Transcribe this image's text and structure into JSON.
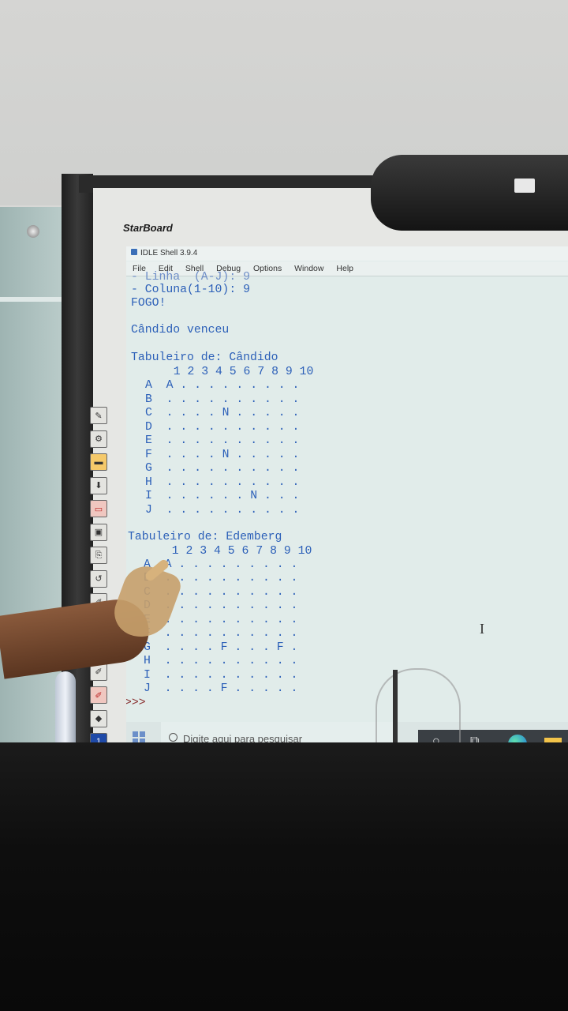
{
  "board_brand": "StarBoard",
  "window": {
    "title": "IDLE Shell 3.9.4",
    "menu": [
      "File",
      "Edit",
      "Shell",
      "Debug",
      "Options",
      "Window",
      "Help"
    ]
  },
  "shell": {
    "line_cut": "- Linha  (A-J): 9",
    "line_coluna": "- Coluna(1-10): 9",
    "line_fogo": "FOGO!",
    "line_winner": "Cândido venceu",
    "prompt": ">>>"
  },
  "boards": [
    {
      "title": "Tabuleiro de: Cândido",
      "header": "  1 2 3 4 5 6 7 8 9 10",
      "rows": [
        "A  A . . . . . . . . .",
        "B  . . . . . . . . . .",
        "C  . . . . N . . . . .",
        "D  . . . . . . . . . .",
        "E  . . . . . . . . . .",
        "F  . . . . N . . . . .",
        "G  . . . . . . . . . .",
        "H  . . . . . . . . . .",
        "I  . . . . . . N . . .",
        "J  . . . . . . . . . ."
      ]
    },
    {
      "title": "Tabuleiro de: Edemberg",
      "header": "  1 2 3 4 5 6 7 8 9 10",
      "rows": [
        "A  A . . . . . . . . .",
        "B  . . . . . . . . . .",
        "C  . . . . . . . . . .",
        "D  . . . . . . . . . .",
        "E  . . . . . . . . . .",
        "F  . . . . . . . . . .",
        "G  . . . . F . . . F .",
        "H  . . . . . . . . . .",
        "I  . . . . . . . . . .",
        "J  . . . . F . . . . ."
      ]
    }
  ],
  "taskbar": {
    "search_placeholder": "Digite aqui para pesquisar"
  },
  "icons": [
    "windows-start-icon",
    "search-icon",
    "cortana-icon",
    "task-view-icon",
    "edge-icon",
    "folder-icon",
    "text-cursor-icon"
  ],
  "colors": {
    "shell_text": "#2b5fb8",
    "screen_bg": "#e1ecea"
  }
}
